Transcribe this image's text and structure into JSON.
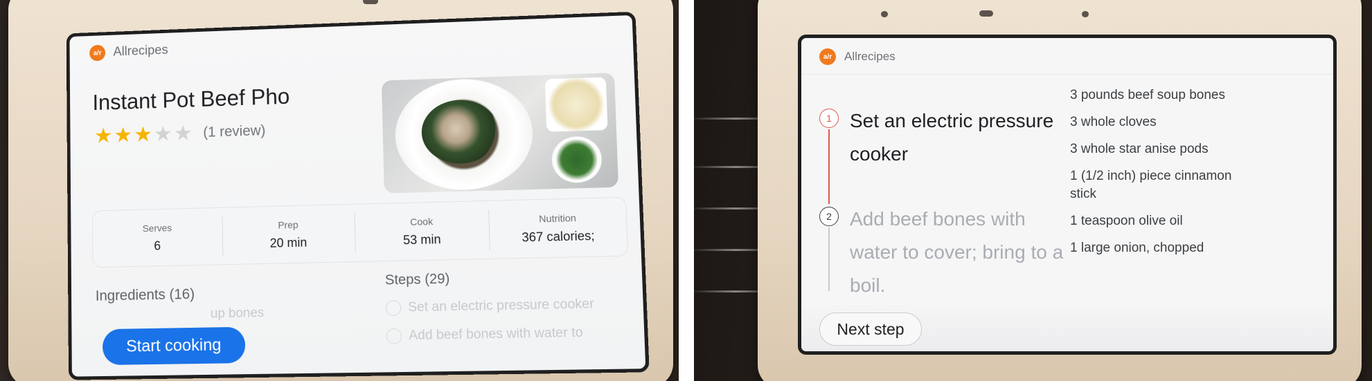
{
  "left_screen": {
    "brand": "Allrecipes",
    "logo_text": "a/r",
    "recipe_title": "Instant Pot Beef Pho",
    "rating": {
      "stars": 3,
      "max": 5,
      "reviews": "(1 review)"
    },
    "info": [
      {
        "label": "Serves",
        "value": "6"
      },
      {
        "label": "Prep",
        "value": "20 min"
      },
      {
        "label": "Cook",
        "value": "53 min"
      },
      {
        "label": "Nutrition",
        "value": "367 calories;"
      }
    ],
    "ingredients_heading": "Ingredients (16)",
    "ingredients_preview": "up bones",
    "steps_heading": "Steps (29)",
    "steps_preview": [
      "Set an electric pressure cooker",
      "Add beef bones with water to"
    ],
    "start_button": "Start cooking"
  },
  "right_screen": {
    "brand": "Allrecipes",
    "logo_text": "a/r",
    "steps": [
      {
        "number": "1",
        "text": "Set an electric pressure cooker",
        "state": "active"
      },
      {
        "number": "2",
        "text": "Add beef bones with water to cover; bring to a boil.",
        "state": "upcoming"
      }
    ],
    "ingredients": [
      "3 pounds beef soup bones",
      "3 whole cloves",
      "3 whole star anise pods",
      "1 (1/2 inch) piece cinnamon stick",
      "1 teaspoon olive oil",
      "1 large onion, chopped"
    ],
    "next_button": "Next step"
  },
  "colors": {
    "accent_blue": "#1a73e8",
    "brand_orange": "#f07a1d",
    "star_gold": "#f4b400",
    "active_step_red": "#e2584a"
  },
  "icons": [
    "allrecipes-logo-icon",
    "star-icon",
    "step-number-icon"
  ]
}
